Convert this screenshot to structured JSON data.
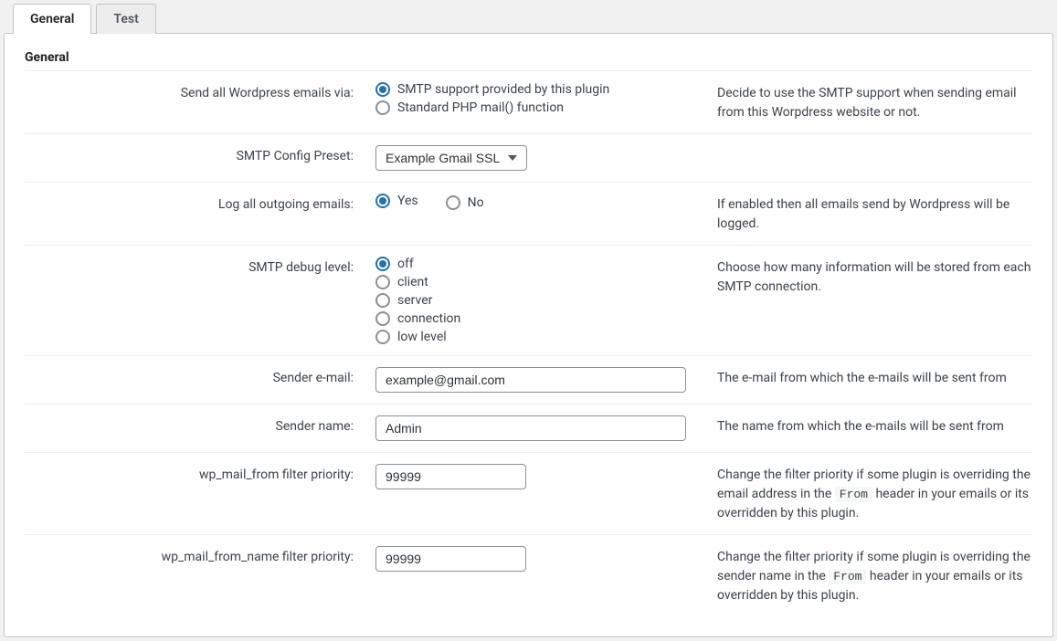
{
  "tabs": {
    "general": "General",
    "test": "Test"
  },
  "section_title": "General",
  "rows": {
    "send_via": {
      "label": "Send all Wordpress emails via:",
      "options": {
        "smtp": "SMTP support provided by this plugin",
        "php": "Standard PHP mail() function"
      },
      "desc": "Decide to use the SMTP support when sending email from this Worpdress website or not."
    },
    "preset": {
      "label": "SMTP Config Preset:",
      "value": "Example Gmail SSL"
    },
    "log": {
      "label": "Log all outgoing emails:",
      "options": {
        "yes": "Yes",
        "no": "No"
      },
      "desc": "If enabled then all emails send by Wordpress will be logged."
    },
    "debug": {
      "label": "SMTP debug level:",
      "options": {
        "off": "off",
        "client": "client",
        "server": "server",
        "connection": "connection",
        "lowlevel": "low level"
      },
      "desc": "Choose how many information will be stored from each SMTP connection."
    },
    "sender_email": {
      "label": "Sender e-mail:",
      "value": "example@gmail.com",
      "desc": "The e-mail from which the e-mails will be sent from"
    },
    "sender_name": {
      "label": "Sender name:",
      "value": "Admin",
      "desc": "The name from which the e-mails will be sent from"
    },
    "filter_from": {
      "label": "wp_mail_from filter priority:",
      "value": "99999",
      "desc_pre": "Change the filter priority if some plugin is overriding the email address in the ",
      "code": "From",
      "desc_post": " header in your emails or its overridden by this plugin."
    },
    "filter_from_name": {
      "label": "wp_mail_from_name filter priority:",
      "value": "99999",
      "desc_pre": "Change the filter priority if some plugin is overriding the sender name in the ",
      "code": "From",
      "desc_post": " header in your emails or its overridden by this plugin."
    }
  }
}
